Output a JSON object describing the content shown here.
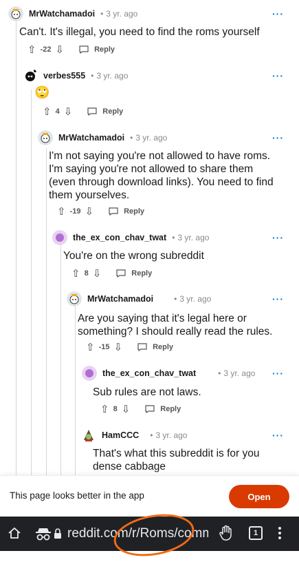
{
  "comments": [
    {
      "user": "MrWatchamadoi",
      "age": "3 yr. ago",
      "body": "Can't. It's illegal, you need to find the roms yourself",
      "score": "-22",
      "reply": "Reply",
      "more": "···"
    },
    {
      "user": "verbes555",
      "age": "3 yr. ago",
      "body": "🙄",
      "score": "4",
      "reply": "Reply",
      "more": "···"
    },
    {
      "user": "MrWatchamadoi",
      "age": "3 yr. ago",
      "body": "I'm not saying you're not allowed to have roms. I'm saying you're not allowed to share them (even through download links). You need to find them yourselves.",
      "score": "-19",
      "reply": "Reply",
      "more": "···"
    },
    {
      "user": "the_ex_con_chav_twat",
      "age": "3 yr. ago",
      "body": "You're on the wrong subreddit",
      "score": "8",
      "reply": "Reply",
      "more": "···"
    },
    {
      "user": "MrWatchamadoi",
      "age": "3 yr. ago",
      "body": "Are you saying that it's legal here or something? I should really read the rules.",
      "score": "-15",
      "reply": "Reply",
      "more": "···"
    },
    {
      "user": "the_ex_con_chav_twat",
      "age": "3 yr. ago",
      "body": "Sub rules are not laws.",
      "score": "8",
      "reply": "Reply",
      "more": "···"
    },
    {
      "user": "HamCCC",
      "age": "3 yr. ago",
      "body": "That's what this subreddit is for you dense cabbage",
      "score": "",
      "reply": "",
      "more": "···"
    }
  ],
  "banner": {
    "text": "This page looks better in the app",
    "open_label": "Open"
  },
  "browser": {
    "url": "reddit.com/r/Roms/comm",
    "tab_count": "1"
  },
  "colors": {
    "accent": "#d93a00",
    "link": "#0079d3",
    "annotation": "#f06a17"
  }
}
